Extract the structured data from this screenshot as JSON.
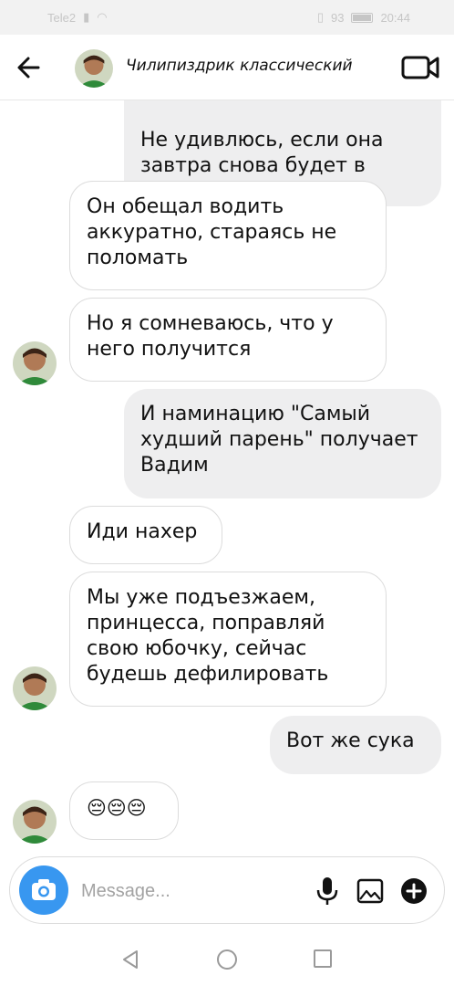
{
  "status_bar": {
    "carrier": "Tele2",
    "battery_percent": "93",
    "time": "20:44"
  },
  "header": {
    "title": "Чилипиздрик классический"
  },
  "messages": [
    {
      "direction": "out",
      "text": "Не удивлюсь, если она завтра снова будет в ремонте"
    },
    {
      "direction": "in",
      "text": "Он обещал водить аккуратно, стараясь не поломать"
    },
    {
      "direction": "in",
      "text": "Но я сомневаюсь, что у него получится"
    },
    {
      "direction": "out",
      "text": "И наминацию \"Самый худший парень\" получает Вадим"
    },
    {
      "direction": "in",
      "text": "Иди нахер"
    },
    {
      "direction": "in",
      "text": "Мы уже подъезжаем, принцесса, поправляй свою юбочку, сейчас будешь дефилировать"
    },
    {
      "direction": "out",
      "text": "Вот же сука"
    },
    {
      "direction": "in",
      "text": "😔😔😔"
    }
  ],
  "composer": {
    "placeholder": "Message...",
    "value": ""
  },
  "colors": {
    "accent": "#3897f0",
    "outgoing_bubble": "#eeeeef",
    "incoming_border": "#dcdcdc"
  },
  "icons": {
    "back": "arrow-left-icon",
    "video": "video-camera-icon",
    "camera": "camera-icon",
    "mic": "microphone-icon",
    "gallery": "gallery-icon",
    "plus": "plus-circle-icon"
  }
}
